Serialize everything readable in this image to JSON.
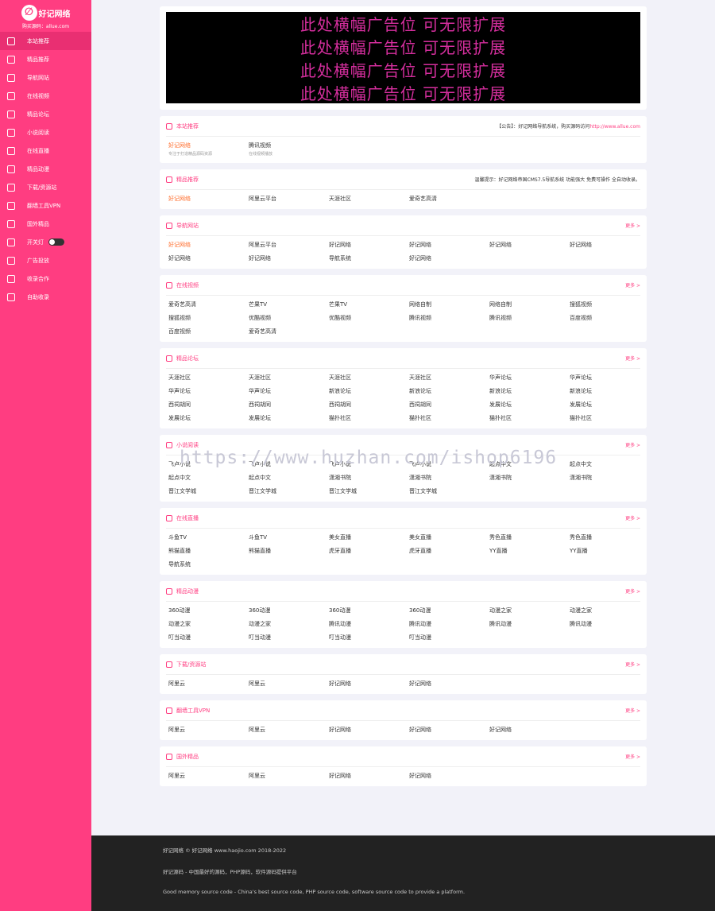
{
  "site": {
    "name": "好记网络",
    "buy_text": "购买源码：allue.com"
  },
  "sidebar": [
    {
      "label": "本站推荐",
      "icon": "globe-icon",
      "active": true
    },
    {
      "label": "精品推荐",
      "icon": "heart-icon"
    },
    {
      "label": "导航网站",
      "icon": "document-icon"
    },
    {
      "label": "在线视频",
      "icon": "film-icon"
    },
    {
      "label": "精品论坛",
      "icon": "chat-icon"
    },
    {
      "label": "小说阅读",
      "icon": "book-icon"
    },
    {
      "label": "在线直播",
      "icon": "video-icon"
    },
    {
      "label": "精品动漫",
      "icon": "book-open-icon"
    },
    {
      "label": "下载/资源站",
      "icon": "download-icon"
    },
    {
      "label": "翻墙工具VPN",
      "icon": "copy-icon"
    },
    {
      "label": "国外精品",
      "icon": "globe2-icon"
    },
    {
      "label": "开关灯",
      "icon": "bulb-icon"
    },
    {
      "label": "广告投放",
      "icon": "clock-icon"
    },
    {
      "label": "收录合作",
      "icon": "globe3-icon"
    },
    {
      "label": "自助收录",
      "icon": "plus-circle-icon"
    }
  ],
  "banner": {
    "lines": [
      "此处横幅广告位 可无限扩展",
      "此处横幅广告位 可无限扩展",
      "此处横幅广告位 可无限扩展",
      "此处横幅广告位 可无限扩展"
    ]
  },
  "sections": [
    {
      "title": "本站推荐",
      "icon": "globe-icon",
      "note": "【公告】：好记网络导航系统，购买源码访问",
      "note_link": "http://www.allue.com",
      "more": "",
      "links": [
        {
          "label": "好记网络",
          "sub": "专注于打造精品源码资源"
        },
        {
          "label": "腾讯视频",
          "sub": "在线视频播放"
        }
      ]
    },
    {
      "title": "精品推荐",
      "icon": "heart-icon",
      "note": "温馨提示：好记网络帝国CMS7.5导航系统 功能强大 免费可操作 全自动收录。",
      "more": "",
      "links": [
        {
          "label": "好记网络"
        },
        {
          "label": "阿里云平台"
        },
        {
          "label": "天涯社区"
        },
        {
          "label": "爱奇艺高清"
        }
      ]
    },
    {
      "title": "导航网站",
      "icon": "document-icon",
      "more": "更多 >",
      "links": [
        {
          "label": "好记网络"
        },
        {
          "label": "阿里云平台"
        },
        {
          "label": "好记网络"
        },
        {
          "label": "好记网络"
        },
        {
          "label": "好记网络"
        },
        {
          "label": "好记网络"
        },
        {
          "label": "好记网络"
        },
        {
          "label": "好记网络"
        },
        {
          "label": "导航系统"
        },
        {
          "label": "好记网络"
        }
      ]
    },
    {
      "title": "在线视频",
      "icon": "film-icon",
      "more": "更多 >",
      "links": [
        {
          "label": "爱奇艺高清"
        },
        {
          "label": "芒果TV"
        },
        {
          "label": "芒果TV"
        },
        {
          "label": "网络自制"
        },
        {
          "label": "网络自制"
        },
        {
          "label": "搜狐视频"
        },
        {
          "label": "搜狐视频"
        },
        {
          "label": "优酷视频"
        },
        {
          "label": "优酷视频"
        },
        {
          "label": "腾讯视频"
        },
        {
          "label": "腾讯视频"
        },
        {
          "label": "百度视频"
        },
        {
          "label": "百度视频"
        },
        {
          "label": "爱奇艺高清"
        }
      ]
    },
    {
      "title": "精品论坛",
      "icon": "chat-icon",
      "more": "更多 >",
      "links": [
        {
          "label": "天涯社区"
        },
        {
          "label": "天涯社区"
        },
        {
          "label": "天涯社区"
        },
        {
          "label": "天涯社区"
        },
        {
          "label": "华声论坛"
        },
        {
          "label": "华声论坛"
        },
        {
          "label": "华声论坛"
        },
        {
          "label": "华声论坛"
        },
        {
          "label": "新浪论坛"
        },
        {
          "label": "新浪论坛"
        },
        {
          "label": "新浪论坛"
        },
        {
          "label": "新浪论坛"
        },
        {
          "label": "西祠胡同"
        },
        {
          "label": "西祠胡同"
        },
        {
          "label": "西祠胡同"
        },
        {
          "label": "西祠胡同"
        },
        {
          "label": "发展论坛"
        },
        {
          "label": "发展论坛"
        },
        {
          "label": "发展论坛"
        },
        {
          "label": "发展论坛"
        },
        {
          "label": "猫扑社区"
        },
        {
          "label": "猫扑社区"
        },
        {
          "label": "猫扑社区"
        },
        {
          "label": "猫扑社区"
        }
      ]
    },
    {
      "title": "小说阅读",
      "icon": "book-icon",
      "more": "更多 >",
      "links": [
        {
          "label": "飞卢小说"
        },
        {
          "label": "飞卢小说"
        },
        {
          "label": "飞卢小说"
        },
        {
          "label": "飞卢小说"
        },
        {
          "label": "起点中文"
        },
        {
          "label": "起点中文"
        },
        {
          "label": "起点中文"
        },
        {
          "label": "起点中文"
        },
        {
          "label": "潇湘书院"
        },
        {
          "label": "潇湘书院"
        },
        {
          "label": "潇湘书院"
        },
        {
          "label": "潇湘书院"
        },
        {
          "label": "晋江文学城"
        },
        {
          "label": "晋江文学城"
        },
        {
          "label": "晋江文学城"
        },
        {
          "label": "晋江文学城"
        }
      ]
    },
    {
      "title": "在线直播",
      "icon": "video-icon",
      "more": "更多 >",
      "links": [
        {
          "label": "斗鱼TV"
        },
        {
          "label": "斗鱼TV"
        },
        {
          "label": "美女直播"
        },
        {
          "label": "美女直播"
        },
        {
          "label": "秀色直播"
        },
        {
          "label": "秀色直播"
        },
        {
          "label": "熊猫直播"
        },
        {
          "label": "熊猫直播"
        },
        {
          "label": "虎牙直播"
        },
        {
          "label": "虎牙直播"
        },
        {
          "label": "YY直播"
        },
        {
          "label": "YY直播"
        },
        {
          "label": "导航系统"
        }
      ]
    },
    {
      "title": "精品动漫",
      "icon": "book-open-icon",
      "more": "更多 >",
      "links": [
        {
          "label": "360动漫"
        },
        {
          "label": "360动漫"
        },
        {
          "label": "360动漫"
        },
        {
          "label": "360动漫"
        },
        {
          "label": "动漫之家"
        },
        {
          "label": "动漫之家"
        },
        {
          "label": "动漫之家"
        },
        {
          "label": "动漫之家"
        },
        {
          "label": "腾讯动漫"
        },
        {
          "label": "腾讯动漫"
        },
        {
          "label": "腾讯动漫"
        },
        {
          "label": "腾讯动漫"
        },
        {
          "label": "叮当动漫"
        },
        {
          "label": "叮当动漫"
        },
        {
          "label": "叮当动漫"
        },
        {
          "label": "叮当动漫"
        }
      ]
    },
    {
      "title": "下载/资源站",
      "icon": "download-icon",
      "more": "更多 >",
      "links": [
        {
          "label": "阿里云"
        },
        {
          "label": "阿里云"
        },
        {
          "label": "好记网络"
        },
        {
          "label": "好记网络"
        }
      ]
    },
    {
      "title": "翻墙工具VPN",
      "icon": "copy-icon",
      "more": "更多 >",
      "links": [
        {
          "label": "阿里云"
        },
        {
          "label": "阿里云"
        },
        {
          "label": "好记网络"
        },
        {
          "label": "好记网络"
        },
        {
          "label": "好记网络"
        }
      ]
    },
    {
      "title": "国外精品",
      "icon": "globe2-icon",
      "more": "更多 >",
      "links": [
        {
          "label": "阿里云"
        },
        {
          "label": "阿里云"
        },
        {
          "label": "好记网络"
        },
        {
          "label": "好记网络"
        }
      ]
    }
  ],
  "watermark": "https://www.huzhan.com/ishop6196",
  "footer": {
    "copyright": "好记网络 © 好记网络 www.haojio.com 2018-2022",
    "desc_cn": "好记源码 - 中国最好的源码，PHP源码，软件源码提供平台",
    "desc_en": "Good memory source code - China's best source code, PHP source code, software source code to provide a platform."
  }
}
